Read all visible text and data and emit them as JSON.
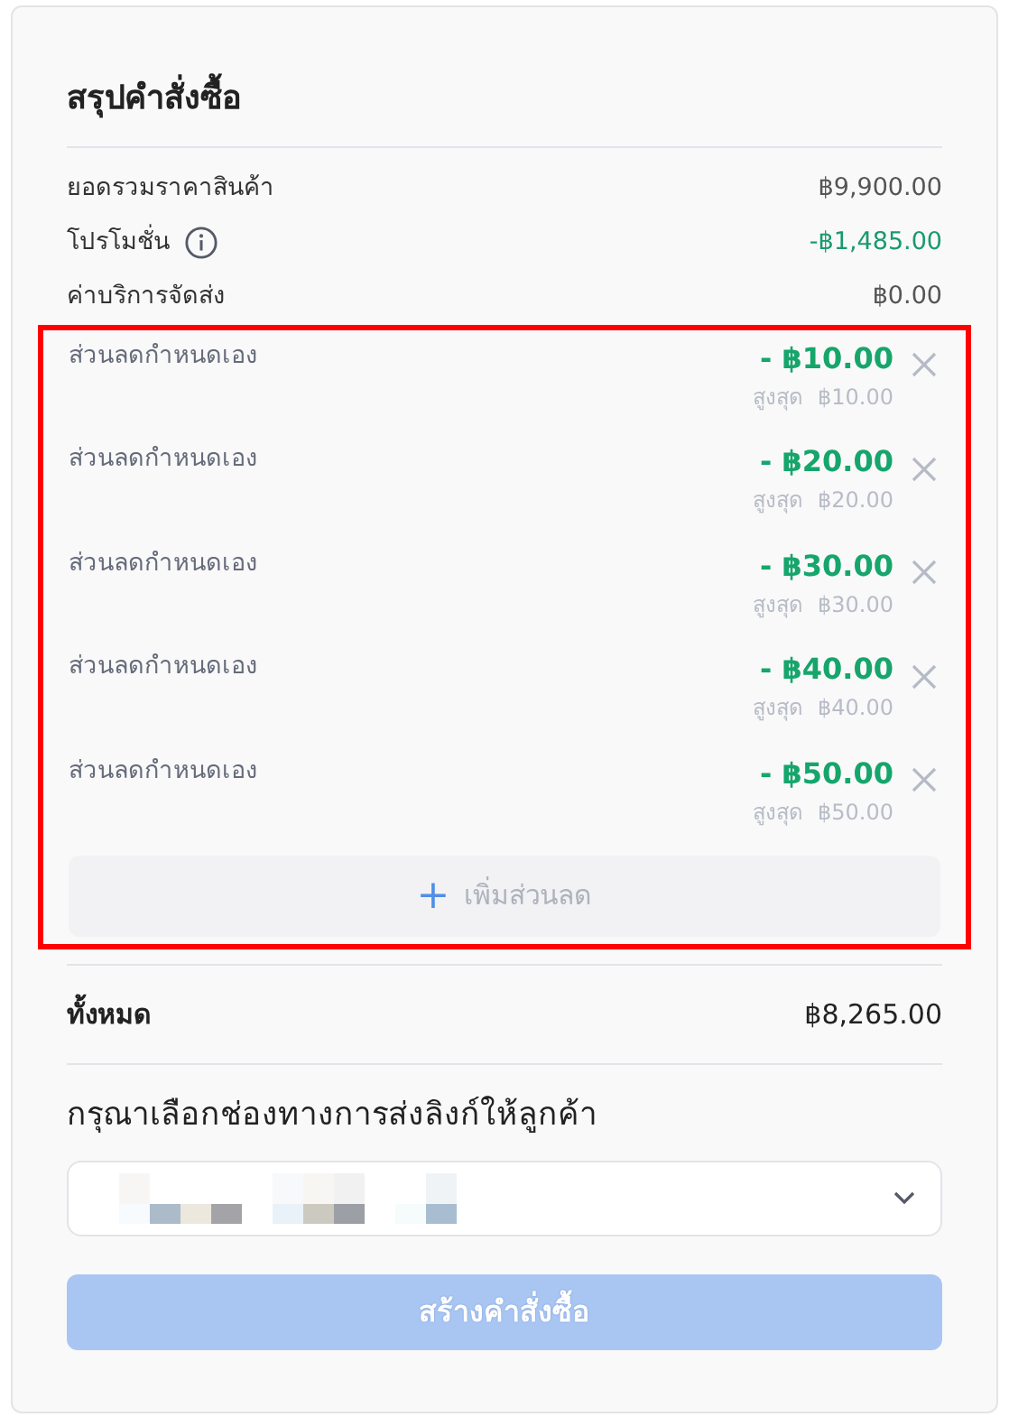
{
  "title": "สรุปคำสั่งซื้อ",
  "summary": [
    {
      "label": "ยอดรวมราคาสินค้า",
      "value": "฿9,900.00",
      "kind": "plain"
    },
    {
      "label": "โปรโมชั่น",
      "value": "-฿1,485.00",
      "kind": "promo"
    },
    {
      "label": "ค่าบริการจัดส่ง",
      "value": "฿0.00",
      "kind": "plain"
    }
  ],
  "discounts": [
    {
      "label": "ส่วนลดกำหนดเอง",
      "amount": "- ฿10.00",
      "max_label": "สูงสุด",
      "max_value": "฿10.00"
    },
    {
      "label": "ส่วนลดกำหนดเอง",
      "amount": "- ฿20.00",
      "max_label": "สูงสุด",
      "max_value": "฿20.00"
    },
    {
      "label": "ส่วนลดกำหนดเอง",
      "amount": "- ฿30.00",
      "max_label": "สูงสุด",
      "max_value": "฿30.00"
    },
    {
      "label": "ส่วนลดกำหนดเอง",
      "amount": "- ฿40.00",
      "max_label": "สูงสุด",
      "max_value": "฿40.00"
    },
    {
      "label": "ส่วนลดกำหนดเอง",
      "amount": "- ฿50.00",
      "max_label": "สูงสุด",
      "max_value": "฿50.00"
    }
  ],
  "add_discount": {
    "icon": "+",
    "label": "เพิ่มส่วนลด"
  },
  "total": {
    "label": "ทั้งหมด",
    "value": "฿8,265.00"
  },
  "channel": {
    "heading": "กรุณาเลือกช่องทางการส่งลิงก์ให้ลูกค้า"
  },
  "submit": {
    "label": "สร้างคำสั่งซื้อ",
    "disabled": true
  }
}
